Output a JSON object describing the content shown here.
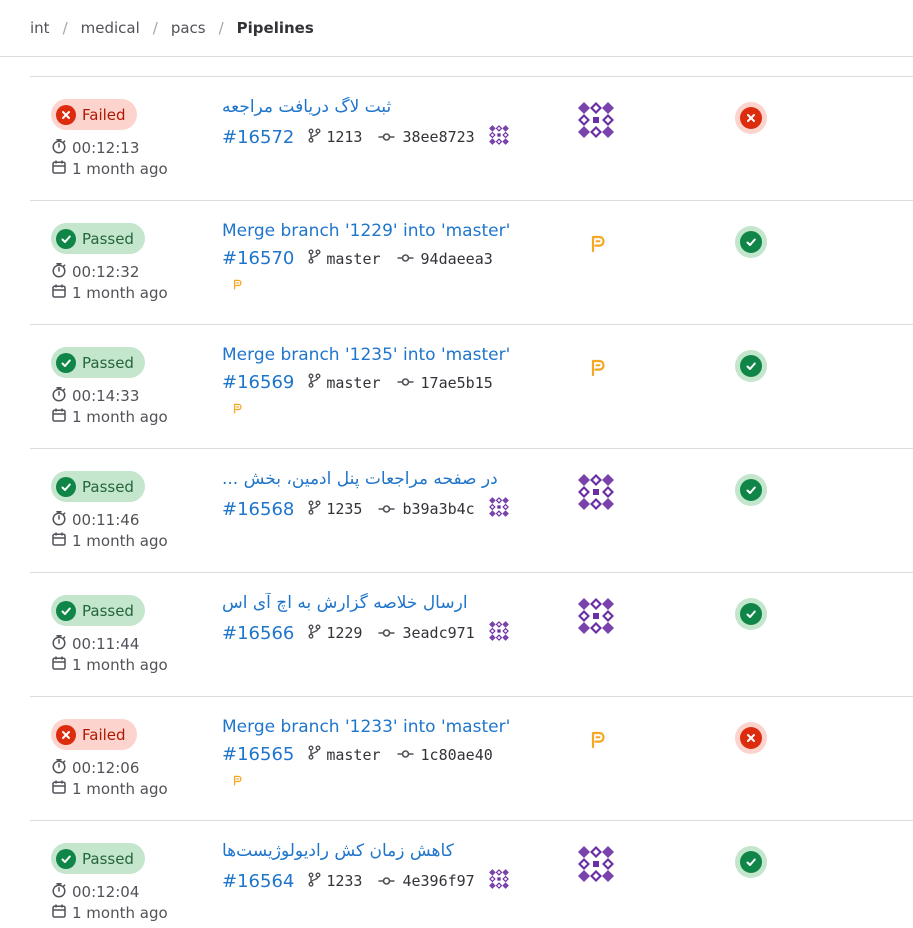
{
  "breadcrumb": {
    "items": [
      "int",
      "medical",
      "pacs"
    ],
    "current": "Pipelines",
    "separator": "/"
  },
  "colors": {
    "link": "#1f75cb",
    "failed": "#dd2b0e",
    "passed": "#108548",
    "avatar_purple": "#6b2fa3",
    "pr_orange": "#f5a623"
  },
  "pipelines": [
    {
      "status": "failed",
      "status_label": "Failed",
      "duration": "00:12:13",
      "finished": "1 month ago",
      "title": "ثبت لاگ دریافت مراجعه",
      "title_rtl": true,
      "id": "#16572",
      "ref": "1213",
      "sha": "38ee8723",
      "author_icon": "identicon-avatar",
      "stage_status": "failed"
    },
    {
      "status": "passed",
      "status_label": "Passed",
      "duration": "00:12:32",
      "finished": "1 month ago",
      "title": "Merge branch '1229' into 'master'",
      "title_rtl": false,
      "id": "#16570",
      "ref": "master",
      "sha": "94daeea3",
      "author_icon": "merge-request-icon",
      "stage_status": "passed"
    },
    {
      "status": "passed",
      "status_label": "Passed",
      "duration": "00:14:33",
      "finished": "1 month ago",
      "title": "Merge branch '1235' into 'master'",
      "title_rtl": false,
      "id": "#16569",
      "ref": "master",
      "sha": "17ae5b15",
      "author_icon": "merge-request-icon",
      "stage_status": "passed"
    },
    {
      "status": "passed",
      "status_label": "Passed",
      "duration": "00:11:46",
      "finished": "1 month ago",
      "title": "در صفحه مراجعات پنل ادمین، بخش ...",
      "title_rtl": true,
      "id": "#16568",
      "ref": "1235",
      "sha": "b39a3b4c",
      "author_icon": "identicon-avatar",
      "stage_status": "passed"
    },
    {
      "status": "passed",
      "status_label": "Passed",
      "duration": "00:11:44",
      "finished": "1 month ago",
      "title": "ارسال خلاصه گزارش به اچ آی اس",
      "title_rtl": true,
      "id": "#16566",
      "ref": "1229",
      "sha": "3eadc971",
      "author_icon": "identicon-avatar",
      "stage_status": "passed"
    },
    {
      "status": "failed",
      "status_label": "Failed",
      "duration": "00:12:06",
      "finished": "1 month ago",
      "title": "Merge branch '1233' into 'master'",
      "title_rtl": false,
      "id": "#16565",
      "ref": "master",
      "sha": "1c80ae40",
      "author_icon": "merge-request-icon",
      "stage_status": "failed"
    },
    {
      "status": "passed",
      "status_label": "Passed",
      "duration": "00:12:04",
      "finished": "1 month ago",
      "title": "کاهش زمان کش رادیولوژیست‌ها",
      "title_rtl": true,
      "id": "#16564",
      "ref": "1233",
      "sha": "4e396f97",
      "author_icon": "identicon-avatar",
      "stage_status": "passed"
    }
  ]
}
